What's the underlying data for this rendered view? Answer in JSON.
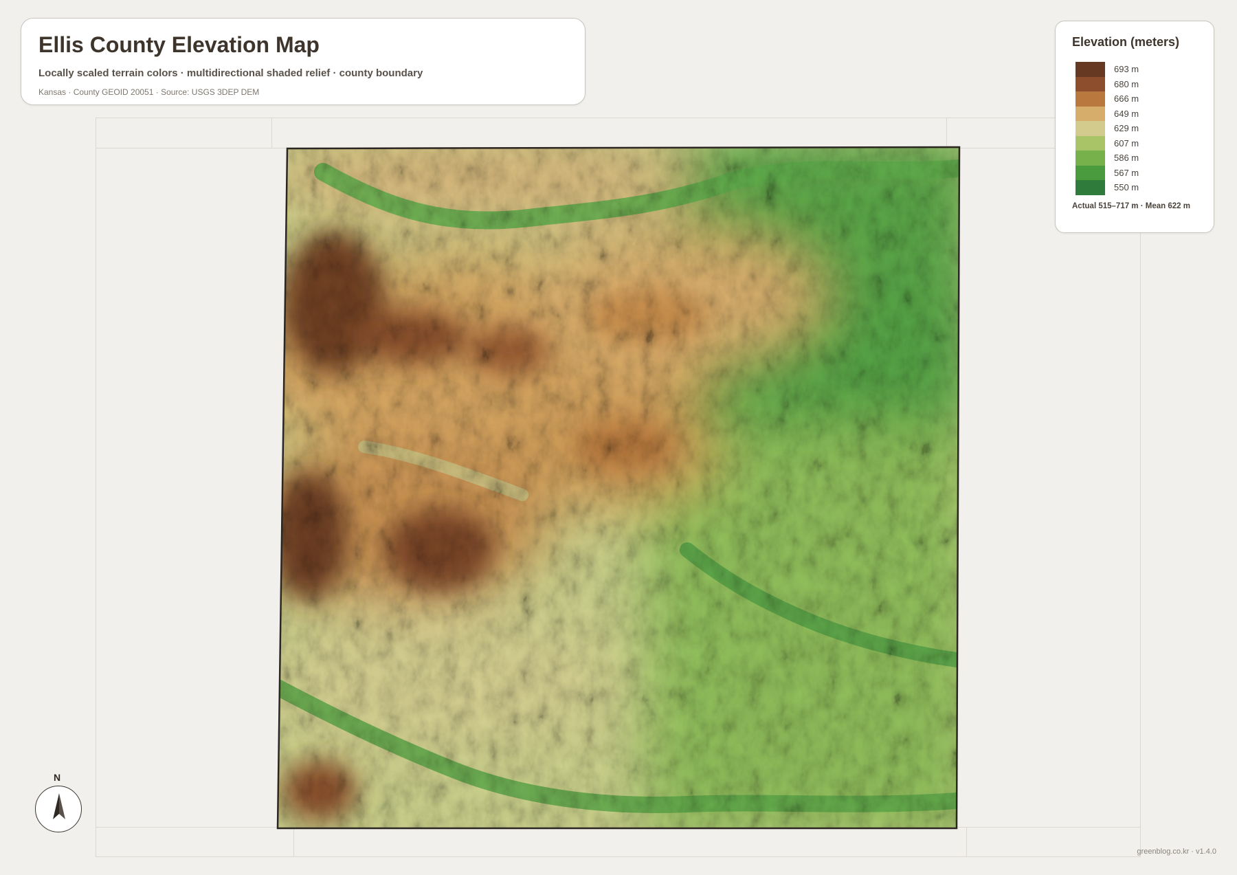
{
  "title_card": {
    "title": "Ellis County Elevation Map",
    "subtitle": "Locally scaled terrain colors · multidirectional shaded relief · county boundary",
    "source": "Kansas · County GEOID 20051 · Source: USGS 3DEP DEM"
  },
  "legend": {
    "title": "Elevation (meters)",
    "items": [
      {
        "label": "693 m",
        "color": "#663a22"
      },
      {
        "label": "680 m",
        "color": "#8c4e2c"
      },
      {
        "label": "666 m",
        "color": "#b8783e"
      },
      {
        "label": "649 m",
        "color": "#d6ad6a"
      },
      {
        "label": "629 m",
        "color": "#d3cb8e"
      },
      {
        "label": "607 m",
        "color": "#a9c466"
      },
      {
        "label": "586 m",
        "color": "#76b14c"
      },
      {
        "label": "567 m",
        "color": "#4a9a3e"
      },
      {
        "label": "550 m",
        "color": "#2f7b3c"
      }
    ],
    "stats": "Actual 515–717 m · Mean 622 m"
  },
  "north_arrow": {
    "label": "N"
  },
  "credit": "greenblog.co.kr · v1.4.0",
  "colors": {
    "background": "#f2f0ec",
    "boundary": "#2b2621",
    "grid": "#dcd8d1"
  }
}
